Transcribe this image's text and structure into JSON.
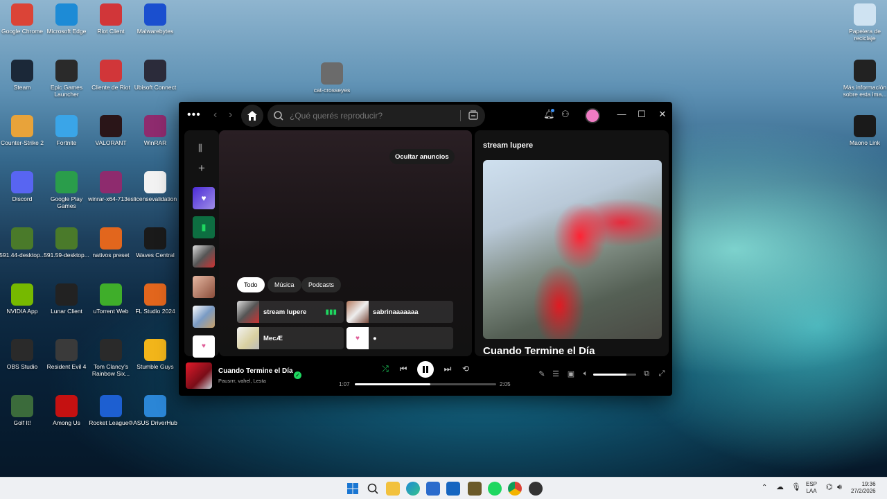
{
  "desktop": {
    "icons": [
      {
        "label": "Google Chrome",
        "color": "#db4437"
      },
      {
        "label": "Microsoft Edge",
        "color": "#1d8bd6"
      },
      {
        "label": "Riot Client",
        "color": "#d13639"
      },
      {
        "label": "Malwarebytes",
        "color": "#1a4fcf"
      },
      {
        "label": "Steam",
        "color": "#1b2838"
      },
      {
        "label": "Epic Games Launcher",
        "color": "#2a2a2a"
      },
      {
        "label": "Cliente de Riot",
        "color": "#d13639"
      },
      {
        "label": "Ubisoft Connect",
        "color": "#2b2b3a"
      },
      {
        "label": "cat-crosseyes",
        "color": "#6b6b6b"
      },
      {
        "label": "Counter-Strike 2",
        "color": "#e8a33a"
      },
      {
        "label": "Fortnite",
        "color": "#3aa5e8"
      },
      {
        "label": "VALORANT",
        "color": "#2a1518"
      },
      {
        "label": "WinRAR",
        "color": "#8e2b6e"
      },
      {
        "label": "Discord",
        "color": "#5865f2"
      },
      {
        "label": "Google Play Games",
        "color": "#2a9d4b"
      },
      {
        "label": "winrar-x64-713es",
        "color": "#8e2b6e"
      },
      {
        "label": "licensevalidation",
        "color": "#f2f2f2"
      },
      {
        "label": "591.44-desktop...",
        "color": "#4a7a2a"
      },
      {
        "label": "591.59-desktop...",
        "color": "#4a7a2a"
      },
      {
        "label": "nativos preset",
        "color": "#e2661d"
      },
      {
        "label": "Waves Central",
        "color": "#1a1a1a"
      },
      {
        "label": "NVIDIA App",
        "color": "#76b900"
      },
      {
        "label": "Lunar Client",
        "color": "#222222"
      },
      {
        "label": "uTorrent Web",
        "color": "#3fae2a"
      },
      {
        "label": "FL Studio 2024",
        "color": "#e2661d"
      },
      {
        "label": "OBS Studio",
        "color": "#2a2a2a"
      },
      {
        "label": "Resident Evil 4",
        "color": "#3a3a3a"
      },
      {
        "label": "Tom Clancy's Rainbow Six...",
        "color": "#2a2a2a"
      },
      {
        "label": "Stumble Guys",
        "color": "#f2b51a"
      },
      {
        "label": "Golf It!",
        "color": "#3b6b3b"
      },
      {
        "label": "Among Us",
        "color": "#c51111"
      },
      {
        "label": "Rocket League®",
        "color": "#1d5fd1"
      },
      {
        "label": "ASUS DriverHub",
        "color": "#2b86d6"
      },
      {
        "label": "Papelera de reciclaje",
        "color": "#cfe3f2"
      },
      {
        "label": "Más información sobre esta ima...",
        "color": "#222222"
      },
      {
        "label": "Maono Link",
        "color": "#1a1a1a"
      }
    ]
  },
  "spotify": {
    "search_placeholder": "¿Qué querés reproducir?",
    "hide_ads": "Ocultar anuncios",
    "chips": [
      "Todo",
      "Música",
      "Podcasts"
    ],
    "cards": [
      {
        "label": "stream lupere"
      },
      {
        "label": "sabrinaaaaaaa"
      },
      {
        "label": "MecÆ"
      },
      {
        "label": "●"
      }
    ],
    "now_playing_panel": {
      "title": "stream lupere",
      "song_title": "Cuando Termine el Día"
    },
    "player": {
      "track": "Cuando Termine el Día",
      "artists": "Pausrrr, vahel, Lesta",
      "elapsed": "1:07",
      "duration": "2:05",
      "progress": 0.535,
      "volume": 0.78
    },
    "accent": "#1ed760"
  },
  "taskbar": {
    "lang_top": "ESP",
    "lang_bottom": "LAA",
    "time": "19:36",
    "date": "27/2/2026"
  }
}
